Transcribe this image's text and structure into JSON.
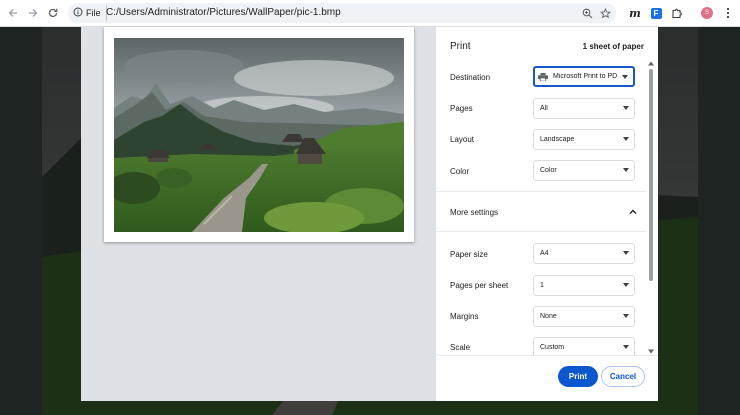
{
  "browser": {
    "file_chip": "File",
    "url": "C:/Users/Administrator/Pictures/WallPaper/pic-1.bmp",
    "profile_initial": "S",
    "icons": [
      "back-arrow-icon",
      "forward-arrow-icon",
      "reload-icon",
      "info-icon",
      "zoom-icon",
      "star-icon",
      "m-extension-icon",
      "f-extension-icon",
      "puzzle-icon",
      "profile-icon",
      "kebab-menu-icon"
    ],
    "colors": {
      "accent": "#0b57d0",
      "profile": "#e46f8a",
      "f_extension": "#1a73e8"
    }
  },
  "print_dialog": {
    "title": "Print",
    "sheet_count": "1 sheet of paper",
    "destination": {
      "label": "Destination",
      "value": "Microsoft Print to PD"
    },
    "pages": {
      "label": "Pages",
      "value": "All"
    },
    "layout": {
      "label": "Layout",
      "value": "Landscape"
    },
    "color": {
      "label": "Color",
      "value": "Color"
    },
    "more_settings": "More settings",
    "paper_size": {
      "label": "Paper size",
      "value": "A4"
    },
    "pages_per_sheet": {
      "label": "Pages per sheet",
      "value": "1"
    },
    "margins": {
      "label": "Margins",
      "value": "None"
    },
    "scale": {
      "label": "Scale",
      "value": "Custom"
    },
    "print_button": "Print",
    "cancel_button": "Cancel"
  }
}
